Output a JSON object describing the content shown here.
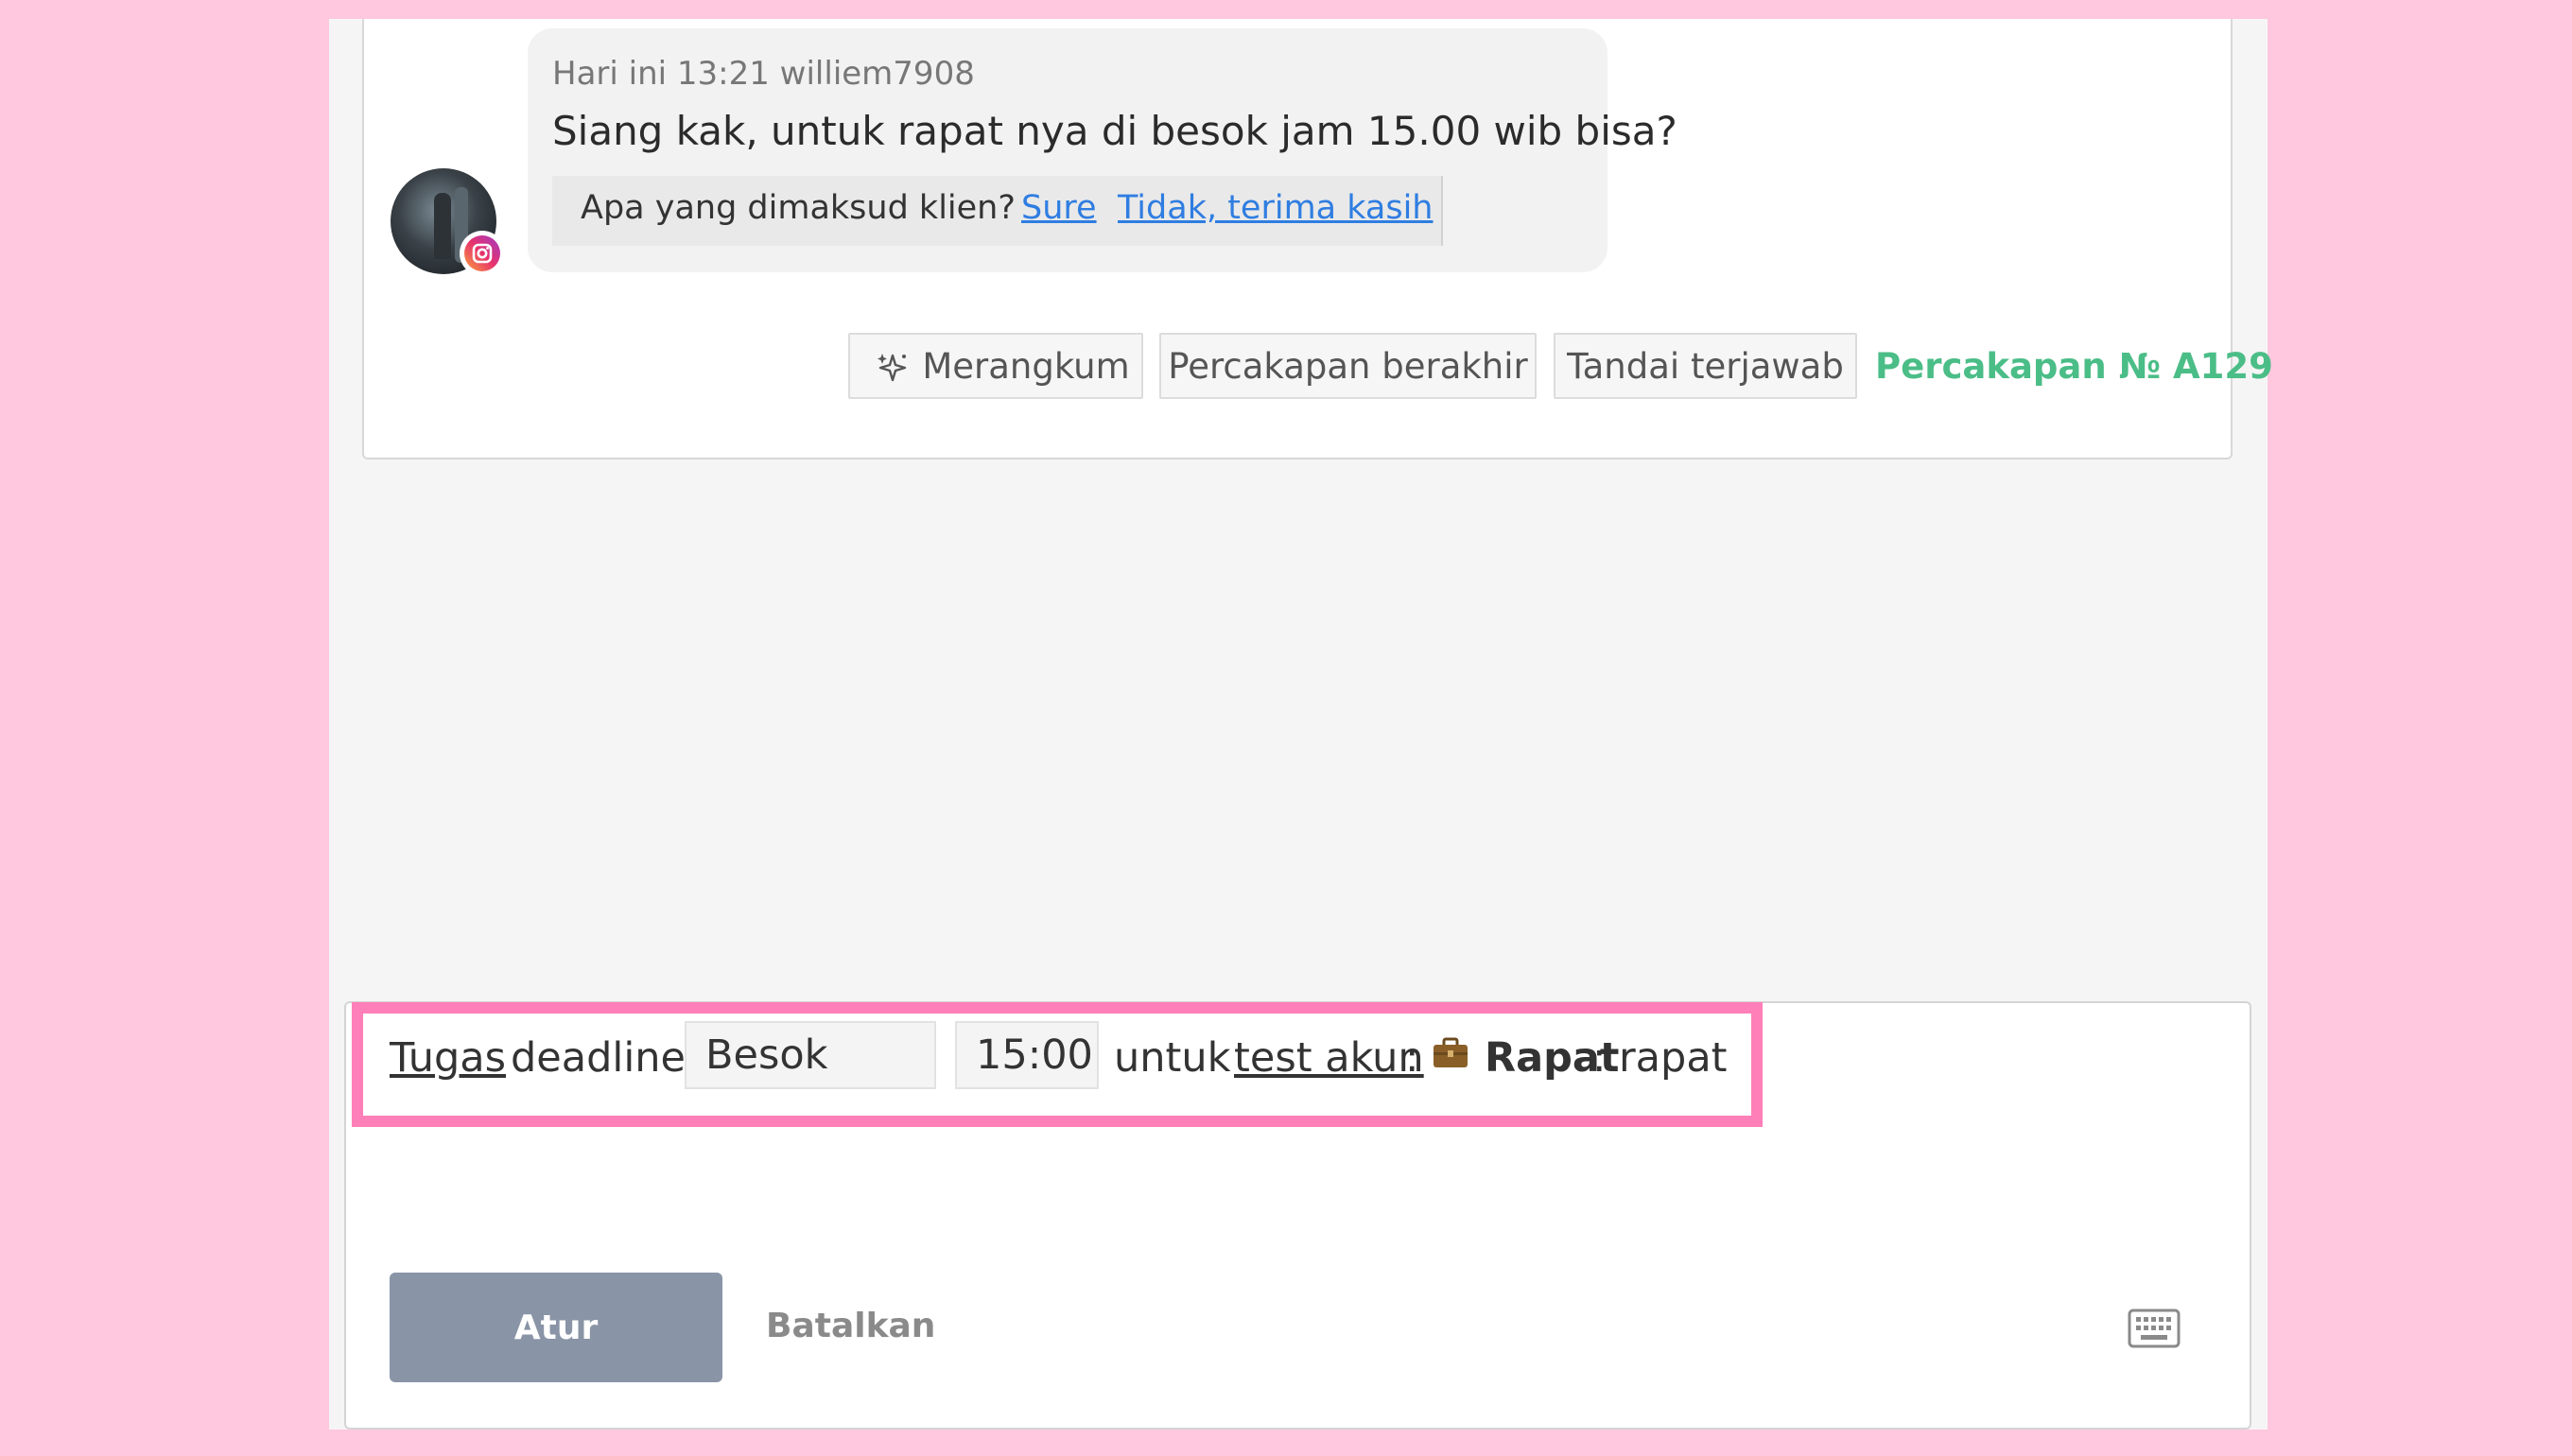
{
  "message": {
    "meta": "Hari ini 13:21 williem7908",
    "text": "Siang kak, untuk rapat nya di besok jam 15.00 wib bisa?",
    "channel_icon": "instagram-icon",
    "intent_question": "Apa yang dimaksud klien?",
    "intent_yes": "Sure",
    "intent_no": "Tidak, terima kasih"
  },
  "actions": {
    "summarize": "Merangkum",
    "summarize_icon": "sparkle-icon",
    "end_conversation": "Percakapan berakhir",
    "mark_answered": "Tandai terjawab",
    "conversation_id": "Percakapan № A129",
    "conversation_id_color": "#4bbd87"
  },
  "task": {
    "link_label": "Tugas",
    "deadline_label": "deadline",
    "date": "Besok",
    "time": "15:00",
    "for_label": "untuk",
    "account": "test akun",
    "colon": ":",
    "type_icon": "briefcase-icon",
    "type": "Rapat",
    "text": "rapat",
    "highlight_color": "#ff7fb9"
  },
  "composer": {
    "submit": "Atur",
    "cancel": "Batalkan",
    "keyboard_icon": "keyboard-icon"
  }
}
